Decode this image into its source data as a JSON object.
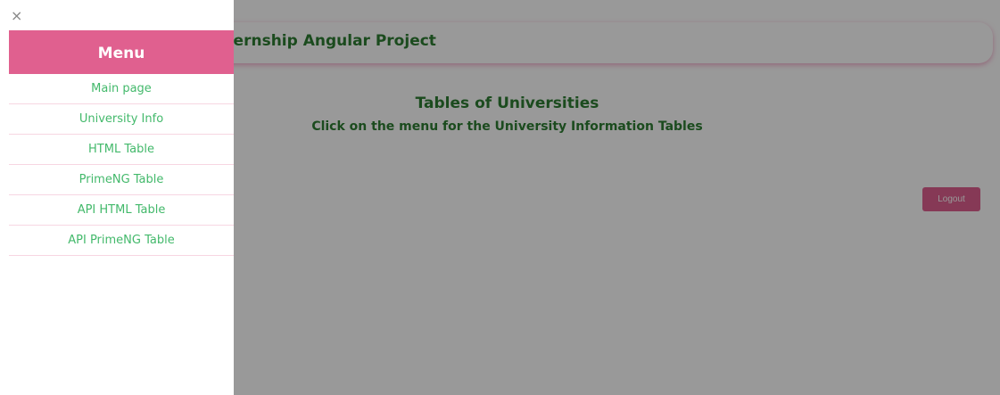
{
  "header": {
    "title": "Internship Angular Project"
  },
  "main": {
    "heading": "Tables of Universities",
    "subheading": "Click on the menu for the University Information Tables",
    "logout_label": "Logout"
  },
  "sidebar": {
    "close_icon": "×",
    "title": "Menu",
    "items": [
      {
        "label": "Main page"
      },
      {
        "label": "University Info"
      },
      {
        "label": "HTML Table"
      },
      {
        "label": "PrimeNG Table"
      },
      {
        "label": "API HTML Table"
      },
      {
        "label": "API PrimeNG Table"
      }
    ]
  },
  "colors": {
    "accent_pink": "#e0608f",
    "text_green": "#2e7d32",
    "menu_link_green": "#43b96b"
  }
}
